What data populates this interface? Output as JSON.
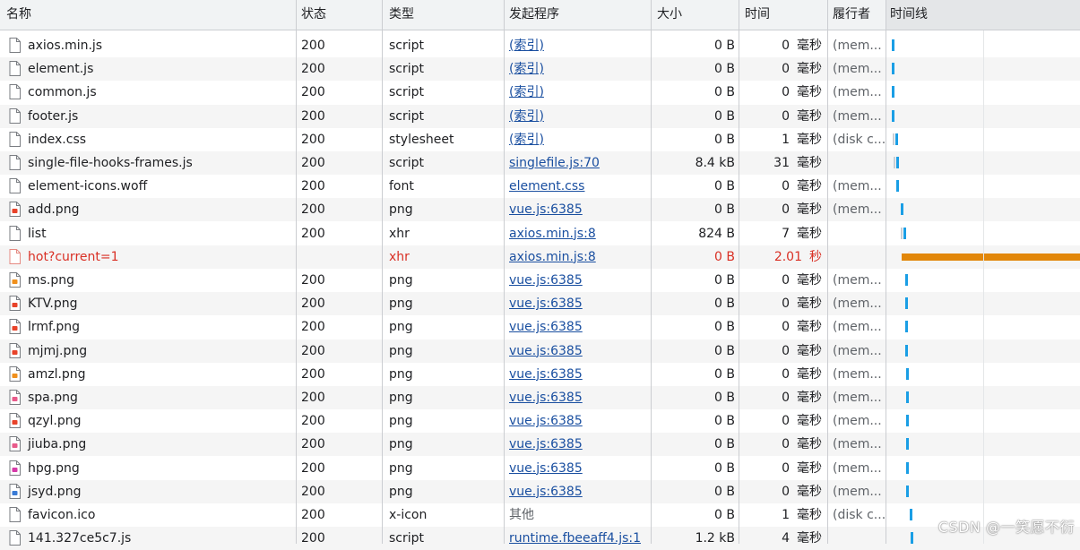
{
  "header": {
    "name": "名称",
    "status": "状态",
    "type": "类型",
    "initiator": "发起程序",
    "size": "大小",
    "time": "时间",
    "executor": "履行者",
    "waterfall": "时间线"
  },
  "rows": [
    {
      "name": "axios.min.js",
      "status": "200",
      "type": "script",
      "initiator": "(索引)",
      "size": "0 B",
      "time": "0",
      "unit": "毫秒",
      "executor": "(mem...",
      "icon": "file-icon"
    },
    {
      "name": "element.js",
      "status": "200",
      "type": "script",
      "initiator": "(索引)",
      "size": "0 B",
      "time": "0",
      "unit": "毫秒",
      "executor": "(mem...",
      "icon": "file-icon"
    },
    {
      "name": "common.js",
      "status": "200",
      "type": "script",
      "initiator": "(索引)",
      "size": "0 B",
      "time": "0",
      "unit": "毫秒",
      "executor": "(mem...",
      "icon": "file-icon"
    },
    {
      "name": "footer.js",
      "status": "200",
      "type": "script",
      "initiator": "(索引)",
      "size": "0 B",
      "time": "0",
      "unit": "毫秒",
      "executor": "(mem...",
      "icon": "file-icon"
    },
    {
      "name": "index.css",
      "status": "200",
      "type": "stylesheet",
      "initiator": "(索引)",
      "size": "0 B",
      "time": "1",
      "unit": "毫秒",
      "executor": "(disk c...",
      "icon": "file-icon"
    },
    {
      "name": "single-file-hooks-frames.js",
      "status": "200",
      "type": "script",
      "initiator": "singlefile.js:70",
      "size": "8.4 kB",
      "time": "31",
      "unit": "毫秒",
      "executor": "",
      "icon": "file-icon"
    },
    {
      "name": "element-icons.woff",
      "status": "200",
      "type": "font",
      "initiator": "element.css",
      "size": "0 B",
      "time": "0",
      "unit": "毫秒",
      "executor": "(mem...",
      "icon": "file-icon"
    },
    {
      "name": "add.png",
      "status": "200",
      "type": "png",
      "initiator": "vue.js:6385",
      "size": "0 B",
      "time": "0",
      "unit": "毫秒",
      "executor": "(mem...",
      "icon": "image-icon-red"
    },
    {
      "name": "list",
      "status": "200",
      "type": "xhr",
      "initiator": "axios.min.js:8",
      "size": "824 B",
      "time": "7",
      "unit": "毫秒",
      "executor": "",
      "icon": "file-icon"
    },
    {
      "name": "hot?current=1",
      "status": "",
      "type": "xhr",
      "initiator": "axios.min.js:8",
      "size": "0 B",
      "time": "2.01",
      "unit": "秒",
      "executor": "",
      "icon": "file-icon-error"
    },
    {
      "name": "ms.png",
      "status": "200",
      "type": "png",
      "initiator": "vue.js:6385",
      "size": "0 B",
      "time": "0",
      "unit": "毫秒",
      "executor": "(mem...",
      "icon": "image-icon-orange"
    },
    {
      "name": "KTV.png",
      "status": "200",
      "type": "png",
      "initiator": "vue.js:6385",
      "size": "0 B",
      "time": "0",
      "unit": "毫秒",
      "executor": "(mem...",
      "icon": "image-icon-red"
    },
    {
      "name": "lrmf.png",
      "status": "200",
      "type": "png",
      "initiator": "vue.js:6385",
      "size": "0 B",
      "time": "0",
      "unit": "毫秒",
      "executor": "(mem...",
      "icon": "image-icon-red"
    },
    {
      "name": "mjmj.png",
      "status": "200",
      "type": "png",
      "initiator": "vue.js:6385",
      "size": "0 B",
      "time": "0",
      "unit": "毫秒",
      "executor": "(mem...",
      "icon": "image-icon-red"
    },
    {
      "name": "amzl.png",
      "status": "200",
      "type": "png",
      "initiator": "vue.js:6385",
      "size": "0 B",
      "time": "0",
      "unit": "毫秒",
      "executor": "(mem...",
      "icon": "image-icon-orange"
    },
    {
      "name": "spa.png",
      "status": "200",
      "type": "png",
      "initiator": "vue.js:6385",
      "size": "0 B",
      "time": "0",
      "unit": "毫秒",
      "executor": "(mem...",
      "icon": "image-icon-pink"
    },
    {
      "name": "qzyl.png",
      "status": "200",
      "type": "png",
      "initiator": "vue.js:6385",
      "size": "0 B",
      "time": "0",
      "unit": "毫秒",
      "executor": "(mem...",
      "icon": "image-icon-red"
    },
    {
      "name": "jiuba.png",
      "status": "200",
      "type": "png",
      "initiator": "vue.js:6385",
      "size": "0 B",
      "time": "0",
      "unit": "毫秒",
      "executor": "(mem...",
      "icon": "image-icon-pink"
    },
    {
      "name": "hpg.png",
      "status": "200",
      "type": "png",
      "initiator": "vue.js:6385",
      "size": "0 B",
      "time": "0",
      "unit": "毫秒",
      "executor": "(mem...",
      "icon": "image-icon-magenta"
    },
    {
      "name": "jsyd.png",
      "status": "200",
      "type": "png",
      "initiator": "vue.js:6385",
      "size": "0 B",
      "time": "0",
      "unit": "毫秒",
      "executor": "(mem...",
      "icon": "image-icon-blue"
    },
    {
      "name": "favicon.ico",
      "status": "200",
      "type": "x-icon",
      "initiator": "其他",
      "size": "0 B",
      "time": "1",
      "unit": "毫秒",
      "executor": "(disk c...",
      "icon": "file-icon"
    },
    {
      "name": "141.327ce5c7.js",
      "status": "200",
      "type": "script",
      "initiator": "runtime.fbeeaff4.js:1",
      "size": "1.2 kB",
      "time": "4",
      "unit": "毫秒",
      "executor": "",
      "icon": "file-icon"
    }
  ],
  "watermark": "CSDN @一笑愿不衍",
  "colors": {
    "link": "#1a4fa0",
    "error": "#d93025",
    "waterfall_bar": "#1a9ee5",
    "waterfall_long": "#e2870a"
  }
}
